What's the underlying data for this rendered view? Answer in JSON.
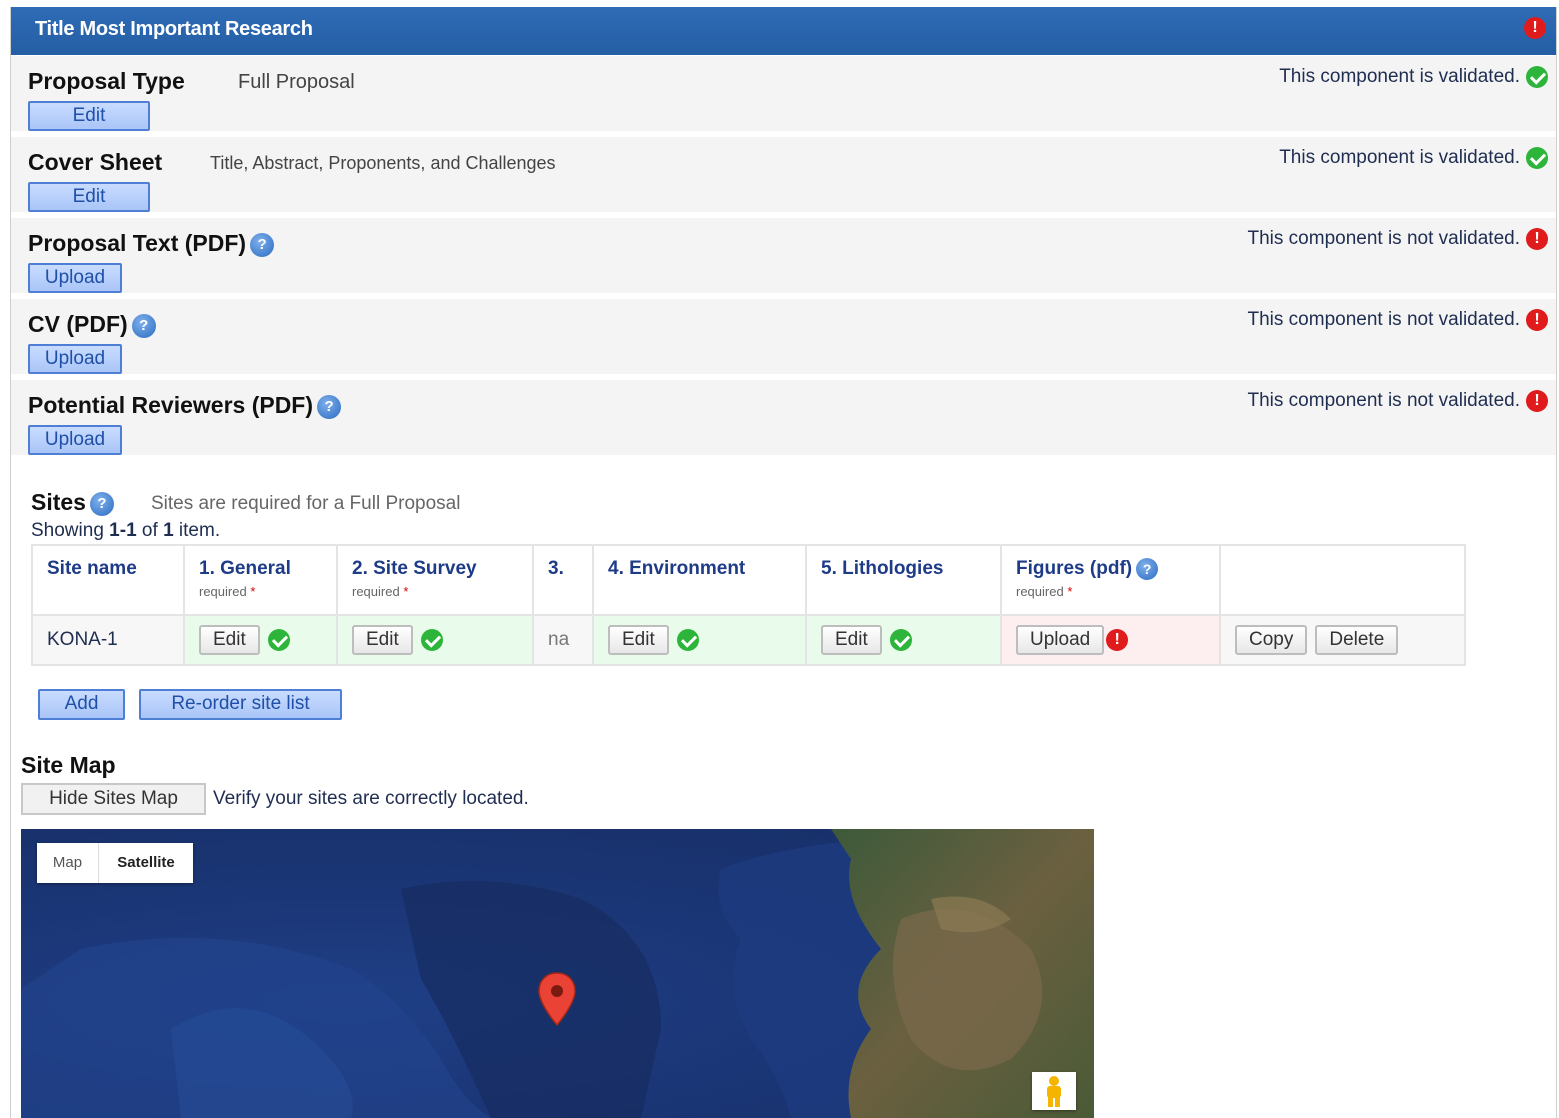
{
  "header": {
    "title": "Title Most Important Research",
    "alert_icon": "exclamation-icon"
  },
  "components": [
    {
      "name": "Proposal Type",
      "desc": "Full Proposal",
      "button": "Edit",
      "status": "This component is validated.",
      "validated": true
    },
    {
      "name": "Cover Sheet",
      "desc": "Title, Abstract, Proponents, and Challenges",
      "button": "Edit",
      "status": "This component is validated.",
      "validated": true
    },
    {
      "name": "Proposal Text (PDF)",
      "desc": "",
      "button": "Upload",
      "status": "This component is not validated.",
      "validated": false
    },
    {
      "name": "CV (PDF)",
      "desc": "",
      "button": "Upload",
      "status": "This component is not validated.",
      "validated": false
    },
    {
      "name": "Potential Reviewers (PDF)",
      "desc": "",
      "button": "Upload",
      "status": "This component is not validated.",
      "validated": false
    }
  ],
  "sites": {
    "title": "Sites",
    "requirement": "Sites are required for a Full Proposal",
    "showing_prefix": "Showing",
    "showing_range": "1-1",
    "showing_of": "of",
    "showing_count": "1",
    "showing_suffix": "item.",
    "columns": [
      {
        "label": "Site name",
        "sub": ""
      },
      {
        "label": "1. General",
        "sub": "required"
      },
      {
        "label": "2. Site Survey",
        "sub": "required"
      },
      {
        "label": "3.",
        "sub": ""
      },
      {
        "label": "4. Environment",
        "sub": ""
      },
      {
        "label": "5. Lithologies",
        "sub": ""
      },
      {
        "label": "Figures (pdf)",
        "sub": "required"
      },
      {
        "label": "",
        "sub": ""
      }
    ],
    "required_mark": "*",
    "row": {
      "site_name": "KONA-1",
      "general_btn": "Edit",
      "survey_btn": "Edit",
      "col3": "na",
      "environment_btn": "Edit",
      "lithologies_btn": "Edit",
      "figures_btn": "Upload",
      "copy_btn": "Copy",
      "delete_btn": "Delete"
    },
    "add_btn": "Add",
    "reorder_btn": "Re-order site list"
  },
  "site_map": {
    "title": "Site Map",
    "hide_btn": "Hide Sites Map",
    "verify_text": "Verify your sites are correctly located.",
    "map_tab": "Map",
    "satellite_tab": "Satellite"
  },
  "colors": {
    "header_blue": "#2a64ad",
    "validated_green": "#2cb53a",
    "error_red": "#e01b1b",
    "ok_cell_bg": "#e9fbea",
    "bad_cell_bg": "#fdeef0"
  }
}
